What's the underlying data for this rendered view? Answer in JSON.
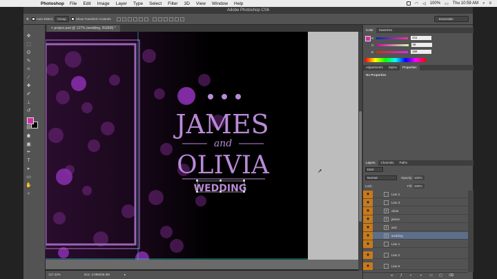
{
  "menubar": {
    "app": "Photoshop",
    "items": [
      "File",
      "Edit",
      "Image",
      "Layer",
      "Type",
      "Select",
      "Filter",
      "3D",
      "View",
      "Window",
      "Help"
    ],
    "battery": "100%",
    "clock": "Thu 10:59 AM"
  },
  "window_title": "Adobe Photoshop CS6",
  "options": {
    "auto_select_label": "Auto-Select:",
    "auto_select_value": "Group",
    "show_transform_label": "Show Transform Controls",
    "workspace": "Essentials"
  },
  "doc_tab": "project.psd @ 127% (wedding, RGB/8) *",
  "artwork": {
    "line1": "JAMES",
    "line2": "and",
    "line3": "OLIVIA",
    "line4": "WEDDING",
    "accent": "#b98ad6"
  },
  "status": {
    "zoom": "127.22%",
    "doc": "Doc: 3.09M/36.3M"
  },
  "color_panel": {
    "tabs": [
      "Color",
      "Swatches"
    ],
    "r": "211",
    "g": "46",
    "b": "168",
    "fg_color": "#d32ea8"
  },
  "props_panel": {
    "tabs": [
      "Adjustments",
      "Styles",
      "Properties"
    ],
    "content": "No Properties"
  },
  "layers_panel": {
    "tabs": [
      "Layers",
      "Channels",
      "Paths"
    ],
    "kind": "Kind",
    "blend": "Normal",
    "opacity_label": "Opacity:",
    "opacity": "100%",
    "lock_label": "Lock:",
    "fill_label": "Fill:",
    "fill": "100%",
    "layers": [
      {
        "name": "Line 2",
        "type": "shape"
      },
      {
        "name": "Line 3",
        "type": "shape"
      },
      {
        "name": "olivia",
        "type": "text"
      },
      {
        "name": "james",
        "type": "text"
      },
      {
        "name": "and",
        "type": "text"
      },
      {
        "name": "wedding",
        "type": "text",
        "selected": true
      },
      {
        "name": "Line 1",
        "type": "shape"
      },
      {
        "name": "Line 2",
        "type": "shape"
      },
      {
        "name": "Line 5",
        "type": "shape"
      }
    ]
  }
}
